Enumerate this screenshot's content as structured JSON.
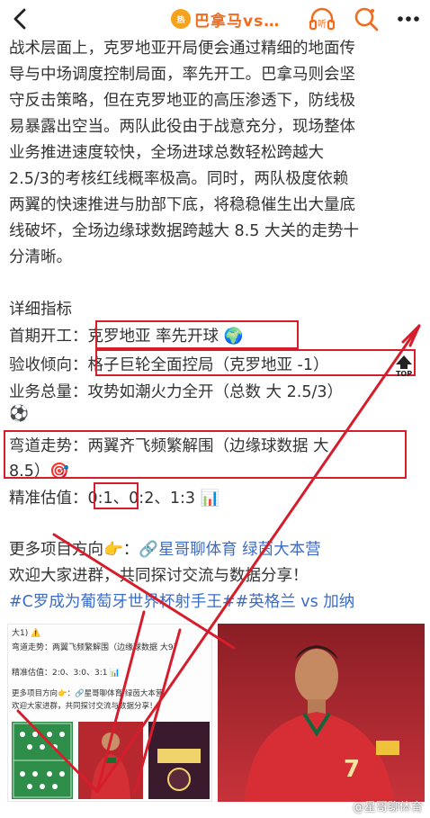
{
  "topbar": {
    "title": "巴拿马vs…",
    "avatar_text": "热"
  },
  "article": {
    "lines": [
      "战术层面上，克罗地亚开局便会通过精细的地面传",
      "导与中场调度控制局面，率先开工。巴拿马则会坚",
      "守反击策略，但在克罗地亚的高压渗透下，防线极",
      "易暴露出空当。两队此役由于战意充分，现场整体",
      "业务推进速度较快，全场进球总数轻松跨越大",
      "2.5/3的考核红线概率极高。同时，两队极度依赖",
      "两翼的快速推进与肋部下底，将稳稳催生出大量底",
      "线破坏，全场边缘球数据跨越大 8.5 大关的走势十",
      "分清晰。"
    ]
  },
  "metrics": {
    "heading": "详细指标",
    "rows": [
      {
        "key": "首期开工：",
        "value": "克罗地亚 率先开球 🌍"
      },
      {
        "key": "验收倾向：",
        "value": "格子巨轮全面控局（克罗地亚 -1）"
      },
      {
        "key": "业务总量：",
        "value": "攻势如潮火力全开（总数 大 2.5/3）"
      },
      {
        "key": "",
        "value": "⚽"
      },
      {
        "key": "弯道走势：",
        "value": "两翼齐飞频繁解围（边缘球数据 大"
      },
      {
        "key": "",
        "value": "8.5）🎯"
      },
      {
        "key": "精准估值：",
        "value": "0:1、",
        "extra": "0:2、1:3 📊"
      }
    ],
    "top_badge": "TOP"
  },
  "footer": {
    "more_label": "更多项目方向👉：",
    "more_link": "🔗星哥聊体育 绿茵大本营",
    "welcome": "欢迎大家进群，共同探讨交流与数据分享！",
    "tags": "#C罗成为葡萄牙世界杯射手王##英格兰 vs 加纳"
  },
  "thumb_left": {
    "lines": [
      "大1) ⚠️",
      "弯道走势：两翼飞频繁解围（边缘球数据 大9)",
      "精准估值：2:0、3:0、3:1 📊",
      "更多项目方向👉：🔗星哥聊体育 绿茵大本营",
      "欢迎大家进群，共同探讨交流与数据分享！"
    ]
  },
  "thumb_right": {
    "jersey_number": "7"
  },
  "watermark": "@星哥聊体育",
  "colors": {
    "accent": "#f26b1d",
    "box_red": "#d61d2c",
    "link_blue": "#3b6cc9"
  }
}
